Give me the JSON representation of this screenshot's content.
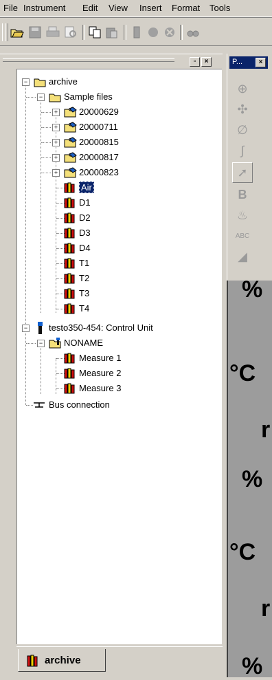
{
  "menu": {
    "file": "File",
    "instrument": "Instrument",
    "edit": "Edit",
    "view": "View",
    "insert": "Insert",
    "format": "Format",
    "tools": "Tools"
  },
  "palette": {
    "title": "P..."
  },
  "tree": {
    "root_archive": "archive",
    "sample_files": "Sample files",
    "dates": [
      "20000629",
      "20000711",
      "20000815",
      "20000817",
      "20000823"
    ],
    "leaves": [
      "Air",
      "D1",
      "D2",
      "D3",
      "D4",
      "T1",
      "T2",
      "T3",
      "T4"
    ],
    "control_unit": "testo350-454: Control Unit",
    "noname": "NONAME",
    "measures": [
      "Measure 1",
      "Measure 2",
      "Measure 3"
    ],
    "bus": "Bus connection"
  },
  "tab": {
    "label": "archive"
  },
  "canvas_units": [
    "%",
    "°C",
    "r",
    "%",
    "°C",
    "r",
    "%"
  ],
  "colors": {
    "selection": "#0a246a",
    "folder": "#f4e07a",
    "book_red": "#d01010",
    "book_yellow": "#f0d000"
  }
}
